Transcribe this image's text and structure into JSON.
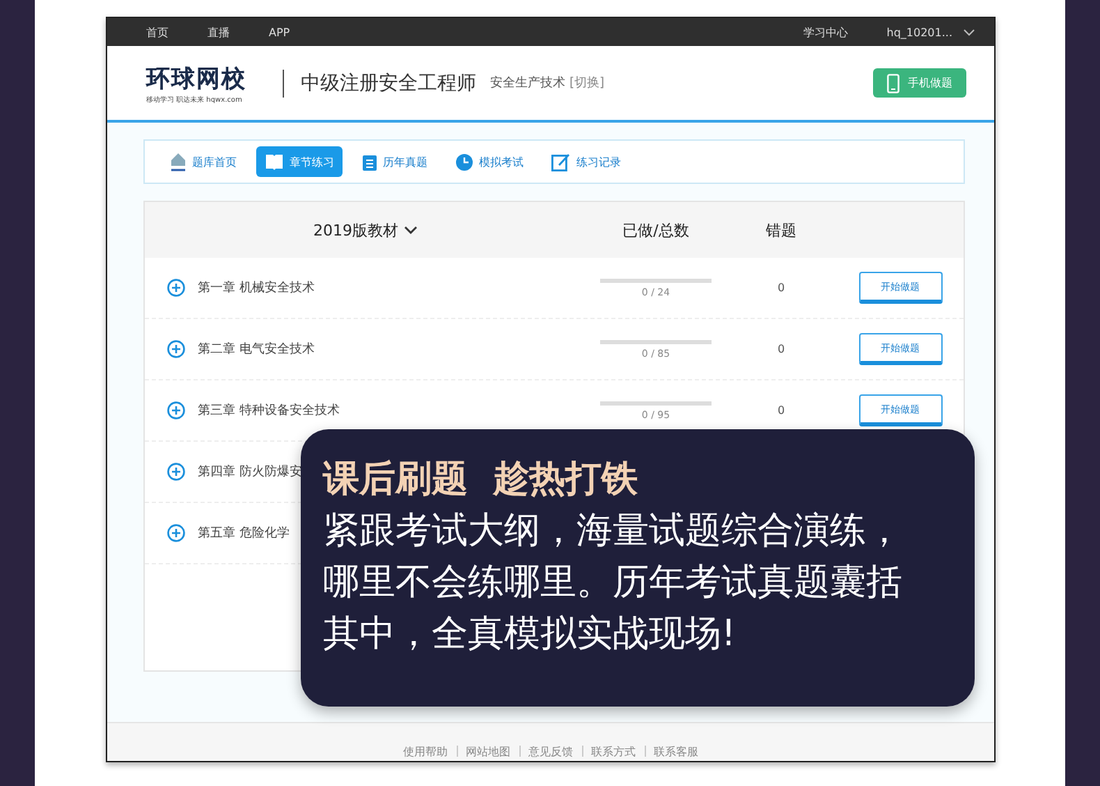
{
  "top_bar": {
    "links": [
      "首页",
      "直播",
      "APP"
    ],
    "study_center": "学习中心",
    "user": "hq_10201..."
  },
  "header": {
    "logo": "环球网校",
    "logo_slogan": "移动学习  职达未来  hqwx.com",
    "exam": "中级注册安全工程师",
    "subject": "安全生产技术",
    "switch": "[切换]",
    "mobile_button": "手机做题"
  },
  "tabs": [
    {
      "label": "题库首页",
      "selected": false
    },
    {
      "label": "章节练习",
      "selected": true
    },
    {
      "label": "历年真题",
      "selected": false
    },
    {
      "label": "模拟考试",
      "selected": false
    },
    {
      "label": "练习记录",
      "selected": false
    }
  ],
  "table": {
    "columns": [
      "2019版教材",
      "已做/总数",
      "错题"
    ],
    "rows": [
      {
        "name": "第一章 机械安全技术",
        "level": 0,
        "progress": "0 / 24",
        "wrong": "0",
        "action": "开始做题"
      },
      {
        "name": "第二章 电气安全技术",
        "level": 0,
        "progress": "0 / 85",
        "wrong": "0",
        "action": "开始做题"
      },
      {
        "name": "第三章 特种设备安全技术",
        "level": 0,
        "progress": "0 / 95",
        "wrong": "0",
        "action": "开始做题"
      },
      {
        "name": "第四章 防火防爆安"
      },
      {
        "name": "第五章 危险化学"
      }
    ]
  },
  "footer": {
    "links": [
      "使用帮助",
      "网站地图",
      "意见反馈",
      "联系方式",
      "联系客服"
    ]
  },
  "promo": {
    "title": "课后刷题  趁热打铁",
    "body": "紧跟考试大纲，海量试题综合演练，哪里不会练哪里。历年考试真题囊括其中，全真模拟实战现场!"
  }
}
